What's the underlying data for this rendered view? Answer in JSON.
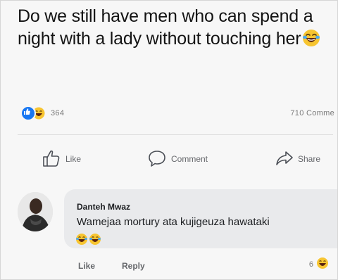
{
  "post": {
    "text": "Do we still have men who can spend a night with a lady without touching her",
    "inline_emoji": "laughing-tears-emoji"
  },
  "reactions": {
    "count": "364",
    "types": [
      "like",
      "haha"
    ],
    "comments_count": "710 Comme"
  },
  "actions": {
    "like_label": "Like",
    "comment_label": "Comment",
    "share_label": "Share"
  },
  "comment": {
    "author": "Danteh Mwaz",
    "text": "Wamejaa mortury ata kujigeuza hawataki",
    "emojis": [
      "laughing-tears-emoji",
      "laughing-tears-emoji"
    ],
    "like_label": "Like",
    "reply_label": "Reply",
    "reaction_count": "6"
  },
  "colors": {
    "like_blue": "#1877f2",
    "haha_yellow": "#f7c531",
    "muted_text": "#65676b",
    "bubble": "#e9eaec"
  }
}
